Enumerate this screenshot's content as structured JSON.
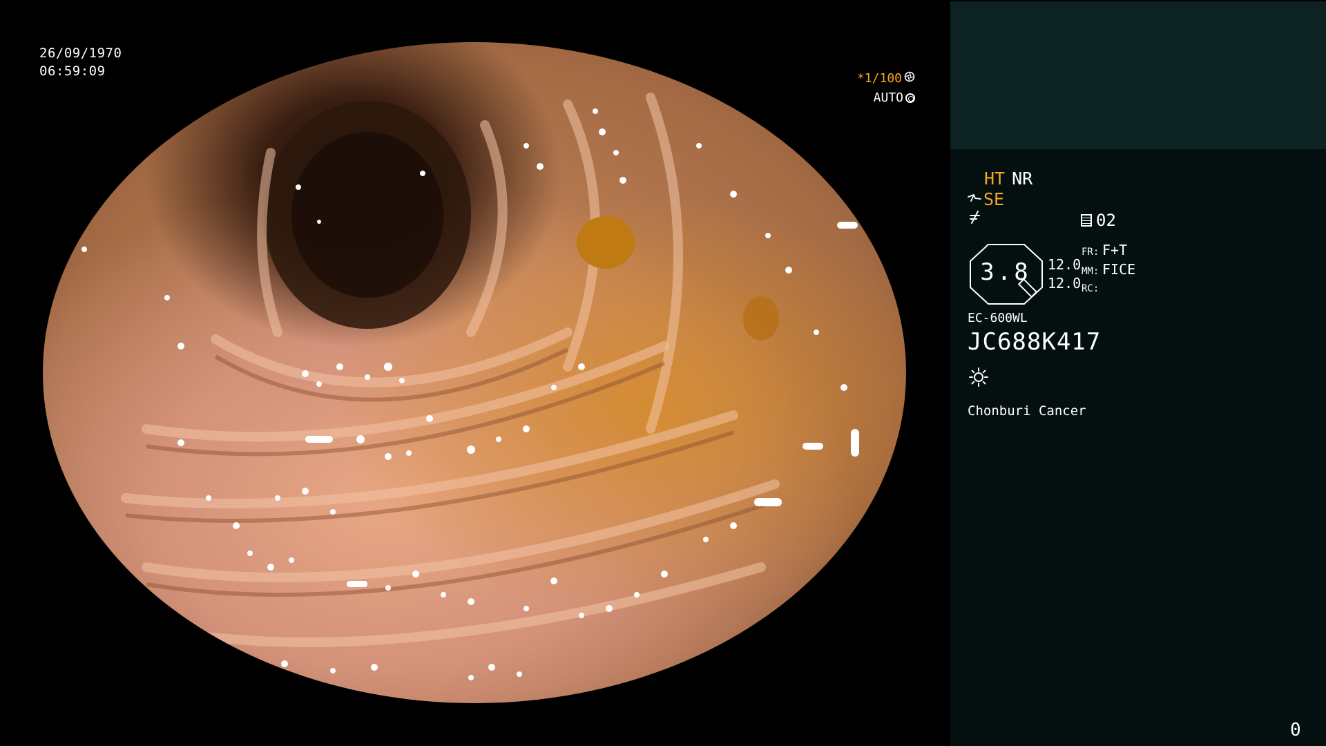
{
  "overlay": {
    "date": "26/09/1970",
    "time": "06:59:09",
    "shutter": "*1/100",
    "exposure": "AUTO"
  },
  "panel": {
    "mode_ht": "HT",
    "mode_nr": "NR",
    "mode_se": "SE",
    "counter": "02",
    "enhance_value": "3.8",
    "fr_label": "FR:",
    "fr_value": "F+T",
    "mm_label": "MM:",
    "mm_value": "FICE",
    "rc_label": "RC:",
    "num1": "12.0",
    "num2": "12.0",
    "model": "EC-600WL",
    "serial": "JC688K417",
    "hospital": "Chonburi Cancer",
    "corner_number": "0"
  },
  "icons": {
    "shutter_icon": "aperture-icon",
    "exposure_icon": "ring-icon",
    "scope_icon": "scope-icon",
    "slash_icon": "not-equal-icon",
    "doc_icon": "document-icon",
    "light_icon": "sun-icon"
  },
  "colors": {
    "accent": "#f5a623",
    "panel_top": "#0d2222",
    "panel_bg": "#04100f"
  }
}
